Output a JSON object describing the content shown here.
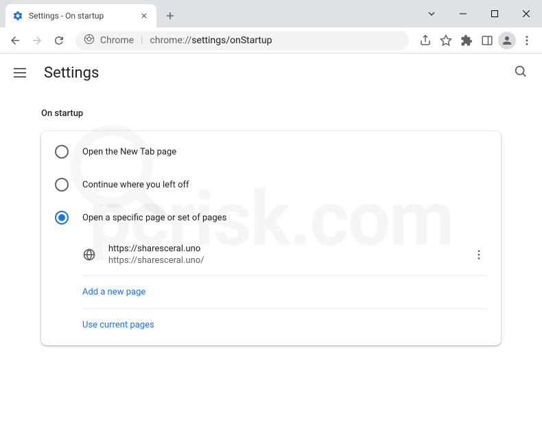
{
  "window": {
    "tab_title": "Settings - On startup"
  },
  "omnibox": {
    "prefix": "Chrome",
    "scheme": "chrome://",
    "path": "settings/onStartup"
  },
  "header": {
    "title": "Settings"
  },
  "section": {
    "title": "On startup"
  },
  "options": {
    "new_tab": "Open the New Tab page",
    "continue": "Continue where you left off",
    "specific": "Open a specific page or set of pages"
  },
  "startup_page": {
    "title": "https://sharesceral.uno",
    "url": "https://sharesceral.uno/"
  },
  "actions": {
    "add_page": "Add a new page",
    "use_current": "Use current pages"
  }
}
